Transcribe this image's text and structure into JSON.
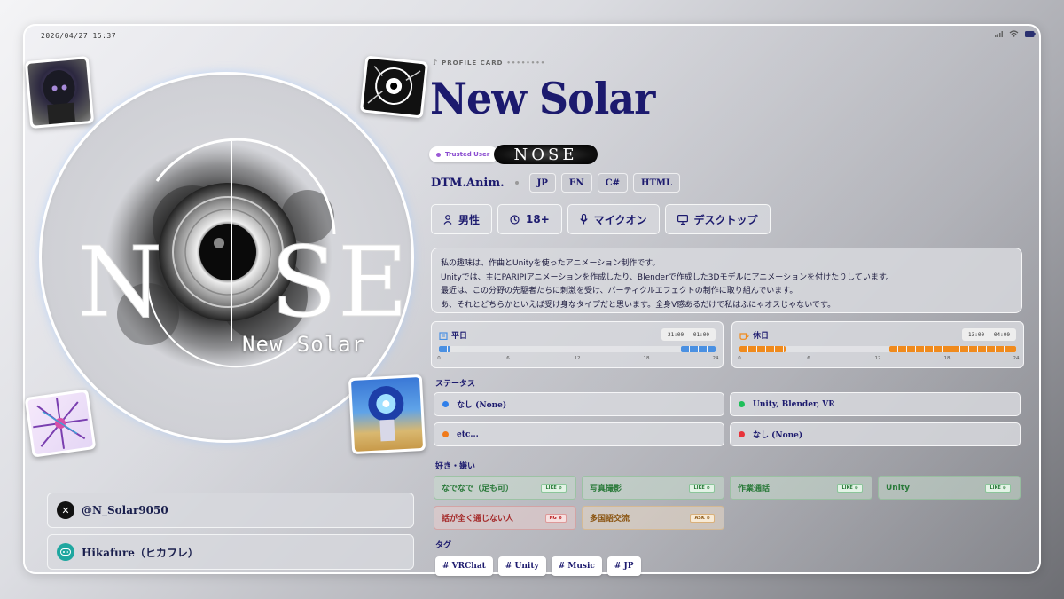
{
  "status_bar": {
    "datetime": "2026/04/27 15:37",
    "icons": [
      "signal-icon",
      "wifi-icon",
      "battery-icon"
    ]
  },
  "profile": {
    "card_label": "PROFILE CARD",
    "name": "New Solar",
    "logo_text": "NOSE",
    "logo_subtitle": "New Solar",
    "trusted_badge": "Trusted User",
    "noise_badge_text": "NOSE",
    "skill_main": "DTM.Anim.",
    "languages": [
      "JP",
      "EN",
      "C#",
      "HTML"
    ]
  },
  "attributes": [
    {
      "icon": "person-icon",
      "label": "男性"
    },
    {
      "icon": "age-icon",
      "label": "18+"
    },
    {
      "icon": "mic-icon",
      "label": "マイクオン"
    },
    {
      "icon": "desktop-icon",
      "label": "デスクトップ"
    }
  ],
  "bio_lines": [
    "私の趣味は、作曲とUnityを使ったアニメーション制作です。",
    "Unityでは、主にPARIPIアニメーションを作成したり、Blenderで作成した3Dモデルにアニメーションを付けたりしています。",
    "最近は、この分野の先駆者たちに刺激を受け、パーティクルエフェクトの制作に取り組んでいます。",
    "あ、それとどちらかといえば受け身なタイプだと思います。全身V感あるだけで私はふにゃオスじゃないです。"
  ],
  "schedule": {
    "weekday": {
      "label": "平日",
      "time": "21:00 - 01:00",
      "ranges": [
        [
          0,
          1
        ],
        [
          21,
          24
        ]
      ],
      "color": "#4a90e2",
      "icon": "building-icon"
    },
    "holiday": {
      "label": "休日",
      "time": "13:00 - 04:00",
      "ranges": [
        [
          0,
          4
        ],
        [
          13,
          24
        ]
      ],
      "color": "#f08a1c",
      "icon": "cup-icon"
    },
    "ticks": [
      "0",
      "6",
      "12",
      "18",
      "24"
    ]
  },
  "status_section": {
    "title": "ステータス",
    "items": [
      {
        "label": "なし (None)",
        "color": "#2f7fea"
      },
      {
        "label": "Unity, Blender, VR",
        "color": "#1fbf5a"
      },
      {
        "label": "etc...",
        "color": "#f07a1a"
      },
      {
        "label": "なし (None)",
        "color": "#e8333b"
      }
    ]
  },
  "likes_section": {
    "title": "好き・嫌い",
    "items": [
      {
        "label": "なでなで（足も可）",
        "tag": "LIKE",
        "kind": "g"
      },
      {
        "label": "写真撮影",
        "tag": "LIKE",
        "kind": "g"
      },
      {
        "label": "作業通話",
        "tag": "LIKE",
        "kind": "g"
      },
      {
        "label": "Unity",
        "tag": "LIKE",
        "kind": "g"
      },
      {
        "label": "話が全く通じない人",
        "tag": "NG",
        "kind": "r"
      },
      {
        "label": "多国語交流",
        "tag": "ASK",
        "kind": "o"
      }
    ]
  },
  "tags_section": {
    "title": "タグ",
    "items": [
      "# VRChat",
      "# Unity",
      "# Music",
      "# JP"
    ]
  },
  "social": [
    {
      "icon": "x-icon",
      "label": "@N_Solar9050"
    },
    {
      "icon": "gamepad-icon",
      "label": "Hikafure（ヒカフレ）"
    }
  ]
}
